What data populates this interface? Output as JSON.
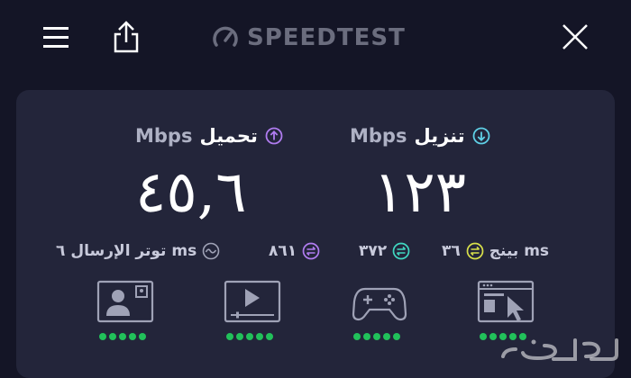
{
  "header": {
    "logo_text": "SPEEDTEST"
  },
  "download": {
    "label": "تنزيل",
    "unit": "Mbps",
    "value": "١٢٣"
  },
  "upload": {
    "label": "تحميل",
    "unit": "Mbps",
    "value": "٤٥,٦"
  },
  "stats": {
    "ping_label": "بينج ms",
    "ping_idle": "٣٦",
    "ping_download": "٣٧٢",
    "ping_upload": "٨٦١",
    "jitter_label": "توتر الإرسال ms",
    "jitter_value": "٦"
  },
  "apps": [
    {
      "icon": "video-chat-icon",
      "rating": 5
    },
    {
      "icon": "video-streaming-icon",
      "rating": 5
    },
    {
      "icon": "gaming-icon",
      "rating": 5
    },
    {
      "icon": "web-browsing-icon",
      "rating": 5
    }
  ],
  "colors": {
    "background": "#141526",
    "card": "#23253a",
    "download_accent": "#5fd0e6",
    "upload_accent": "#b07cf0",
    "ping_idle": "#d8e04a",
    "ping_download": "#40d6c0",
    "ping_upload": "#b07cf0",
    "rating_dot": "#21c15a"
  }
}
